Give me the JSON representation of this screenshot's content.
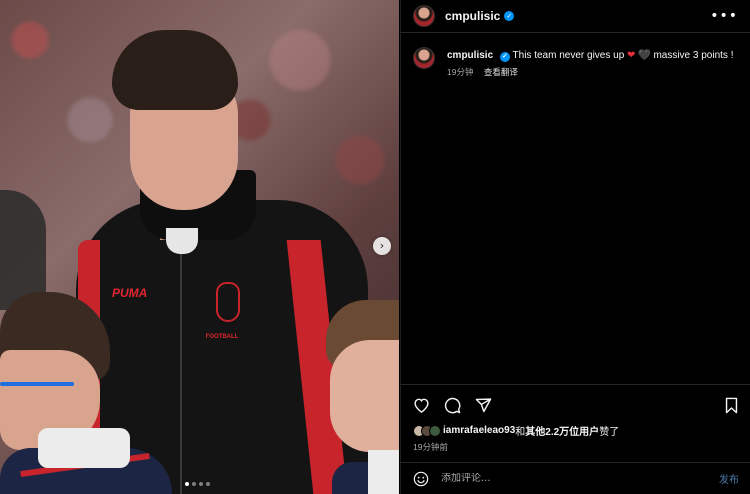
{
  "post": {
    "username": "cmpulisic",
    "caption_text": "This team never gives up",
    "caption_tail": "massive 3 points !",
    "caption_time": "19分钟",
    "translate_label": "查看翻译",
    "more_label": "•••"
  },
  "media": {
    "brand_text": "PUMA",
    "sponsor_text": "FOOTBALL",
    "next_label": "›",
    "carousel_count": 4,
    "carousel_active": 1
  },
  "likes": {
    "first_user": "iamrafaeleao93",
    "connector": "和",
    "others": "其他2.2万位用户",
    "suffix": "赞了"
  },
  "post_time": "19分钟前",
  "comment": {
    "placeholder": "添加评论...",
    "post_label": "发布"
  },
  "colors": {
    "accent_verified": "#0095f6",
    "heart_red": "#ed2e3b",
    "milan_red": "#c8242b"
  },
  "icons": [
    "heart-icon",
    "comment-icon",
    "share-icon",
    "bookmark-icon",
    "emoji-icon",
    "verified-icon",
    "more-icon",
    "chevron-right-icon"
  ]
}
